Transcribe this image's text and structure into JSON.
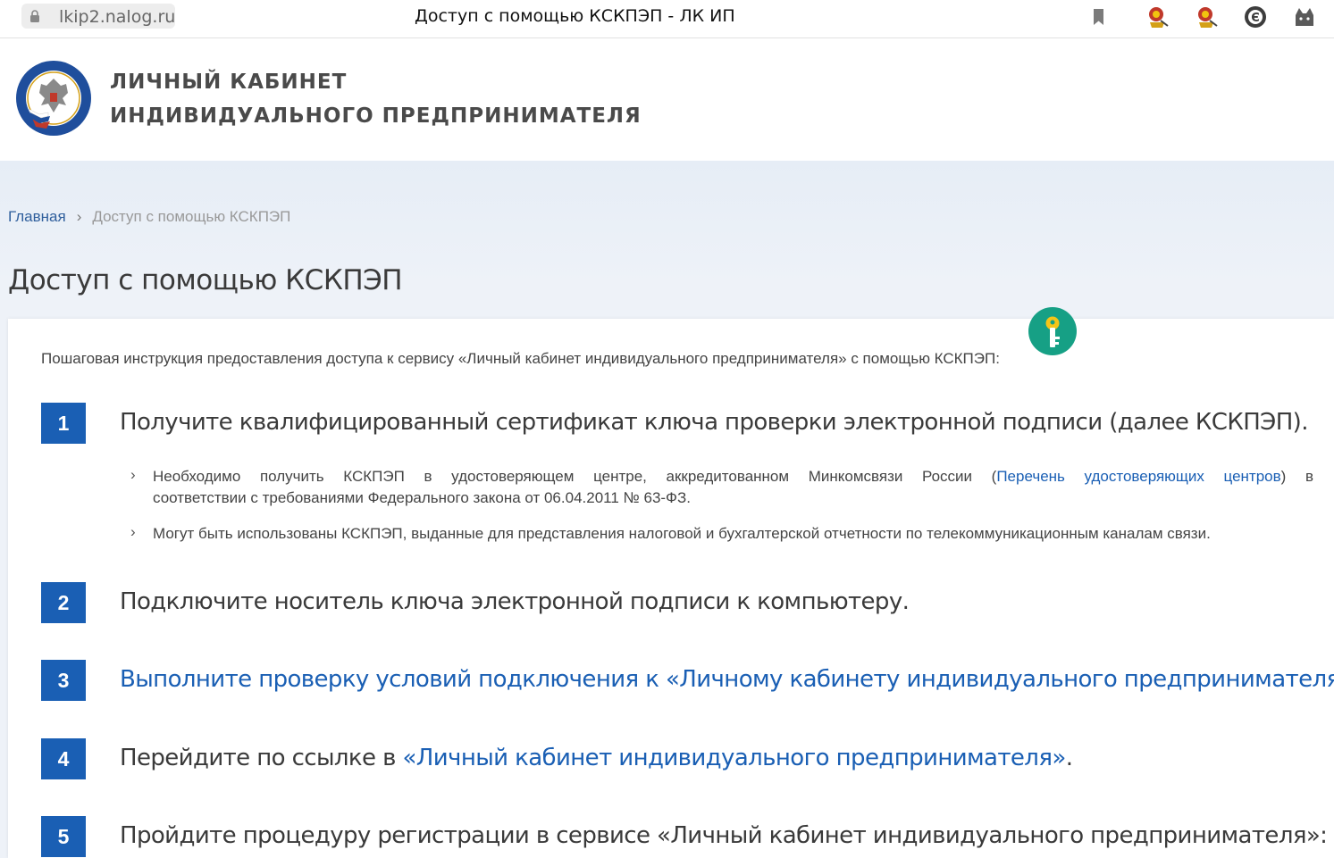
{
  "browser": {
    "url": "lkip2.nalog.ru",
    "tab_title": "Доступ с помощью КСКПЭП - ЛК ИП",
    "icons": [
      "lock-icon",
      "bookmark-icon",
      "extension-stamp-icon",
      "extension-stamp-icon",
      "extension-e-icon",
      "extension-cat-icon"
    ]
  },
  "header": {
    "brand_line1": "ЛИЧНЫЙ КАБИНЕТ",
    "brand_line2": "ИНДИВИДУАЛЬНОГО ПРЕДПРИНИМАТЕЛЯ",
    "emblem": "fns-emblem"
  },
  "breadcrumb": {
    "home": "Главная",
    "separator": "›",
    "current": "Доступ с помощью КСКПЭП"
  },
  "page": {
    "title": "Доступ с помощью КСКПЭП",
    "intro": "Пошаговая инструкция предоставления доступа к сервису «Личный кабинет индивидуального предпринимателя» с помощью КСКПЭП:",
    "steps": [
      {
        "num": "1",
        "text": "Получите квалифицированный сертификат ключа проверки электронной подписи (далее КСКПЭП).",
        "bullets": [
          {
            "pre": "Необходимо получить КСКПЭП в удостоверяющем центре, аккредитованном Минкомсвязи России (",
            "link": "Перечень удостоверяющих центров",
            "post": ") в",
            "line2": "соответствии с требованиями Федерального закона от 06.04.2011 № 63-ФЗ."
          },
          {
            "text": "Могут быть использованы КСКПЭП, выданные для представления налоговой и бухгалтерской отчетности по телекоммуникационным каналам связи."
          }
        ]
      },
      {
        "num": "2",
        "text": "Подключите носитель ключа электронной подписи к компьютеру."
      },
      {
        "num": "3",
        "link": "Выполните проверку условий подключения к «Личному кабинету индивидуального предпринимателя»",
        "post": "."
      },
      {
        "num": "4",
        "pre": "Перейдите по ссылке в ",
        "link": "«Личный кабинет индивидуального предпринимателя»",
        "post": "."
      },
      {
        "num": "5",
        "text": "Пройдите процедуру регистрации в сервисе «Личный кабинет индивидуального предпринимателя»:"
      }
    ]
  },
  "colors": {
    "accent": "#1a5fb4",
    "link": "#1a5fb4",
    "key_badge": "#16a085",
    "key": "#f5c518"
  }
}
